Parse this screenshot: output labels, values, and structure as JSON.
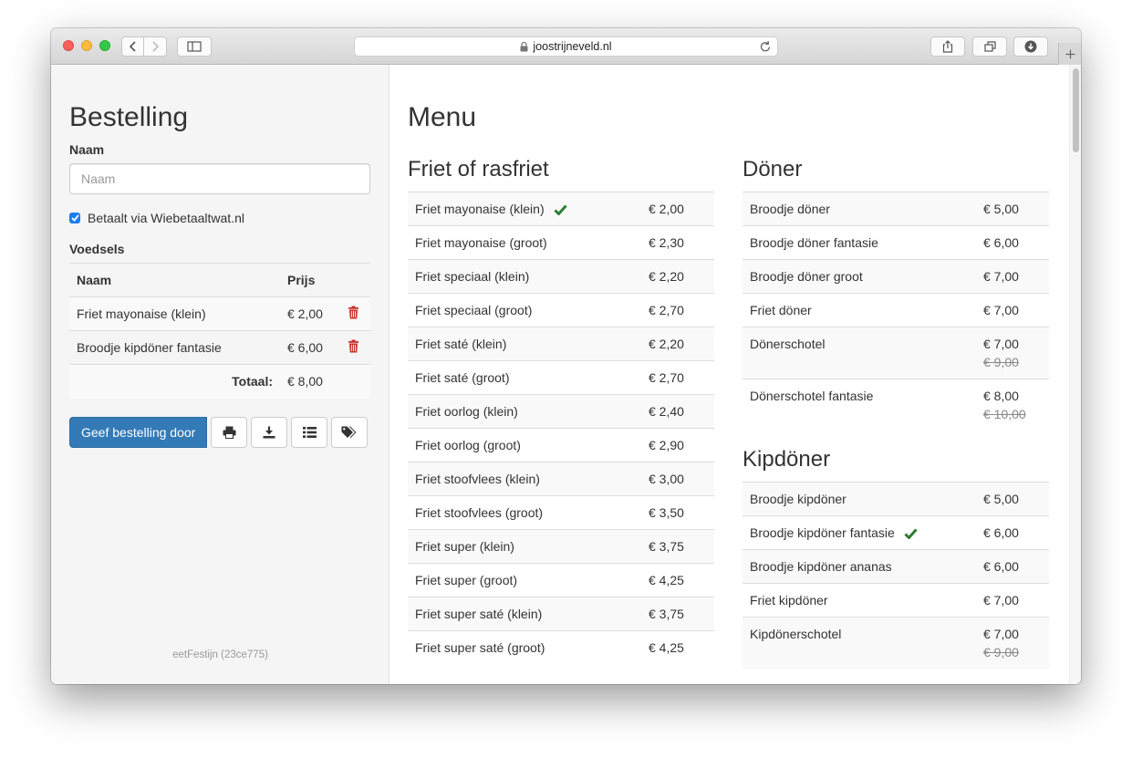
{
  "browser": {
    "url": "joostrijneveld.nl"
  },
  "sidebar": {
    "title": "Bestelling",
    "name_label": "Naam",
    "name_placeholder": "Naam",
    "paid_label": "Betaalt via Wiebetaaltwat.nl",
    "paid_checked": true,
    "food_label": "Voedsels",
    "table": {
      "col_name": "Naam",
      "col_price": "Prijs",
      "rows": [
        {
          "name": "Friet mayonaise (klein)",
          "price": "€ 2,00"
        },
        {
          "name": "Broodje kipdöner fantasie",
          "price": "€ 6,00"
        }
      ],
      "total_label": "Totaal:",
      "total_value": "€ 8,00"
    },
    "submit_label": "Geef bestelling door",
    "footer": "eetFestijn (23ce775)"
  },
  "menu": {
    "title": "Menu",
    "sections": {
      "friet": {
        "title": "Friet of rasfriet",
        "items": [
          {
            "name": "Friet mayonaise (klein)",
            "price": "€ 2,00",
            "selected": true
          },
          {
            "name": "Friet mayonaise (groot)",
            "price": "€ 2,30"
          },
          {
            "name": "Friet speciaal (klein)",
            "price": "€ 2,20"
          },
          {
            "name": "Friet speciaal (groot)",
            "price": "€ 2,70"
          },
          {
            "name": "Friet saté (klein)",
            "price": "€ 2,20"
          },
          {
            "name": "Friet saté (groot)",
            "price": "€ 2,70"
          },
          {
            "name": "Friet oorlog (klein)",
            "price": "€ 2,40"
          },
          {
            "name": "Friet oorlog (groot)",
            "price": "€ 2,90"
          },
          {
            "name": "Friet stoofvlees (klein)",
            "price": "€ 3,00"
          },
          {
            "name": "Friet stoofvlees (groot)",
            "price": "€ 3,50"
          },
          {
            "name": "Friet super (klein)",
            "price": "€ 3,75"
          },
          {
            "name": "Friet super (groot)",
            "price": "€ 4,25"
          },
          {
            "name": "Friet super saté (klein)",
            "price": "€ 3,75"
          },
          {
            "name": "Friet super saté (groot)",
            "price": "€ 4,25"
          }
        ]
      },
      "doner": {
        "title": "Döner",
        "items": [
          {
            "name": "Broodje döner",
            "price": "€ 5,00"
          },
          {
            "name": "Broodje döner fantasie",
            "price": "€ 6,00"
          },
          {
            "name": "Broodje döner groot",
            "price": "€ 7,00"
          },
          {
            "name": "Friet döner",
            "price": "€ 7,00"
          },
          {
            "name": "Dönerschotel",
            "price": "€ 7,00",
            "old_price": "€ 9,00"
          },
          {
            "name": "Dönerschotel fantasie",
            "price": "€ 8,00",
            "old_price": "€ 10,00"
          }
        ]
      },
      "kipdoner": {
        "title": "Kipdöner",
        "items": [
          {
            "name": "Broodje kipdöner",
            "price": "€ 5,00"
          },
          {
            "name": "Broodje kipdöner fantasie",
            "price": "€ 6,00",
            "selected": true
          },
          {
            "name": "Broodje kipdöner ananas",
            "price": "€ 6,00"
          },
          {
            "name": "Friet kipdöner",
            "price": "€ 7,00"
          },
          {
            "name": "Kipdönerschotel",
            "price": "€ 7,00",
            "old_price": "€ 9,00"
          }
        ]
      }
    }
  },
  "colors": {
    "primary": "#337ab7",
    "check": "#2e7d32",
    "trash": "#c9302c"
  },
  "icons": {
    "select": "check-icon",
    "remove": "trash-icon",
    "print": "print-icon",
    "download": "download-icon",
    "list": "list-icon",
    "tags": "tags-icon"
  }
}
